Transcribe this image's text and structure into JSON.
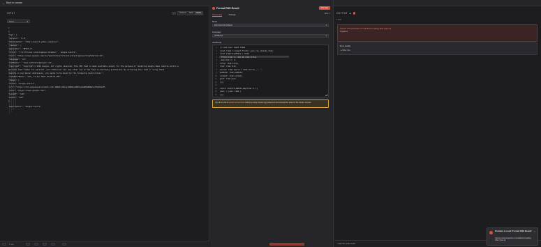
{
  "topbar": {
    "back_label": "Back to canvas"
  },
  "input": {
    "title": "INPUT",
    "node_selector": "Feed",
    "view_modes": [
      "Schema",
      "Table",
      "JSON"
    ],
    "active_view": "JSON",
    "json_lines": [
      "[",
      "  {",
      "    \"rss\": {",
      "      \"version\": \"2.0\",",
      "      \"xmlns:media\": \"http://search.yahoo.com/mrss/\",",
      "      \"channel\": {",
      "        \"generator\": \"NFE/5.0\",",
      "        \"title\": \"\\\"artificial intelligence threats\\\" - Google Alerts\",",
      "        \"link\": \"https://news.google.com/rss/search?q=artificial+intelligence+threats&hl=en-US\",",
      "        \"language\": \"en\",",
      "        \"webMaster\": \"news-webmaster@google.com\",",
      "        \"copyright\": \"Copyright © 2024 Google. All rights reserved. This XML feed is made available solely for the purpose of rendering Google News results within a",
      "          personal feed reader for personal, non-commercial use. Any other use of the feed is expressly prohibited. By accessing this feed or using these",
      "          results in any manner whatsoever, you agree to be bound by the foregoing restrictions.\",",
      "        \"lastBuildDate\": \"Sat, 13 Apr 2024 19:06:43 GMT\",",
      "        \"image\": {",
      "          \"title\": \"Google Alerts\",",
      "          \"url\": \"https://lh3.googleusercontent.com/-DR60l-K8vnyi99NIovm8HlXyZwQ85mMDRw=w7fbbddsIM\",",
      "          \"link\": \"https://news.google.com/\",",
      "          \"height\": \"128\",",
      "          \"width\": \"128\"",
      "        },",
      "        \"description\": \"Google Alerts\""
    ]
  },
  "node": {
    "title": "Format RSS Result",
    "test_step_label": "Test step",
    "docs_label": "Docs ↗",
    "tabs": [
      "Parameters",
      "Settings"
    ],
    "active_tab": "Parameters",
    "mode_label": "Mode",
    "mode_value": "Run Once for All Items",
    "language_label": "Language",
    "language_value": "JavaScript",
    "code_label": "JavaScript",
    "code_lines": [
      "// Loop over input items",
      "const items = $input.first().json.rss.channel.item;",
      "const simplifiedData = items",
      "  .filter(item => item && item.title)",
      "  .map(item => ({",
      "    title: item.title,",
      "    link: item.link,",
      "    source: item.source ? item.source._ : '',",
      "    pubDate: item.pubDate,",
      "    content: item.content,",
      "    guid: item.guid",
      "  }));",
      "",
      "return simplifiedData.map(item => ({",
      "  json: { json: item }",
      "}));"
    ],
    "tip_text": "Type $ for a list of",
    "tip_link": "special vars/methods",
    "tip_rest": ". Debug by using console.log() statements and viewing their output in the browser console."
  },
  "output": {
    "title": "OUTPUT",
    "item_count": "1 item",
    "error_title": "Cannot read properties of undefined (reading 'filter') [line 3]",
    "error_type": "TypeError",
    "details_title": "Error details",
    "other_info_label": "Other info",
    "wish_label": "I wish this node would..."
  },
  "input_footer": {
    "label": "1 item"
  },
  "toast": {
    "title": "Problem in node 'Format RSS Result'",
    "message": "Cannot read properties of undefined (reading 'filter') [line 3]",
    "close": "×"
  },
  "colors": {
    "accent": "#ff6d5a",
    "error": "#d2553e",
    "warning": "#d9a23a"
  }
}
